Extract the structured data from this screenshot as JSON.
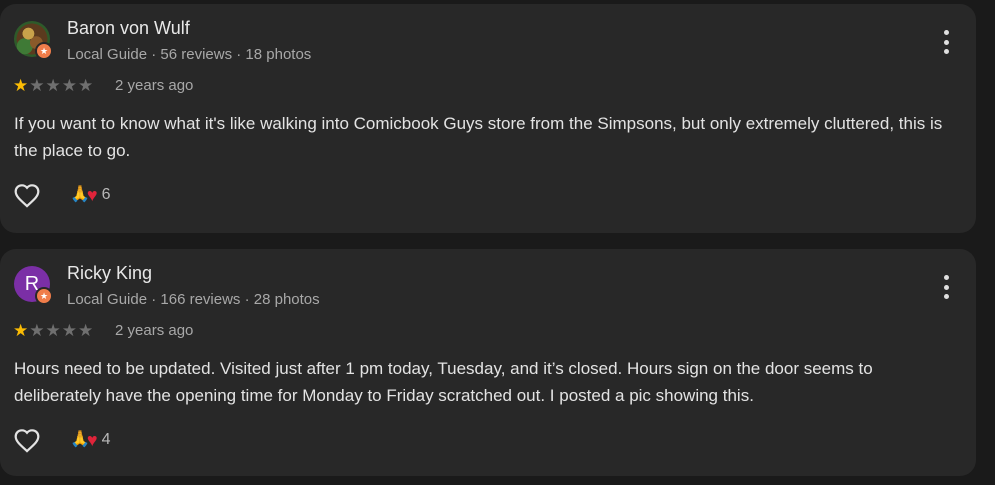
{
  "reviews": [
    {
      "author": "Baron von Wulf",
      "meta": "Local Guide · 56 reviews · 18 photos",
      "avatar_letter": "",
      "rating": 1,
      "max_rating": 5,
      "date": "2 years ago",
      "text": "If you want to know what it's like walking into Comicbook Guys store from the Simpsons, but only extremely cluttered, this is the place to go.",
      "reaction_count": "6"
    },
    {
      "author": "Ricky King",
      "meta": "Local Guide · 166 reviews · 28 photos",
      "avatar_letter": "R",
      "rating": 1,
      "max_rating": 5,
      "date": "2 years ago",
      "text": "Hours need to be updated. Visited just after 1 pm today, Tuesday, and it’s closed. Hours sign on the door seems to deliberately have the opening time for Monday to Friday scratched out. I posted a pic showing this.",
      "reaction_count": "4"
    }
  ],
  "icons": {
    "menu": "more-vert-icon",
    "like": "heart-outline-icon",
    "reaction_1": "pray-icon",
    "reaction_2": "heart-icon",
    "guide_badge": "star-badge-icon",
    "star": "star-icon"
  },
  "colors": {
    "star_filled": "#fbbc04",
    "star_empty": "#6f6f6f",
    "badge": "#f07d4a",
    "avatar_letter_bg": "#7b2fa6"
  }
}
